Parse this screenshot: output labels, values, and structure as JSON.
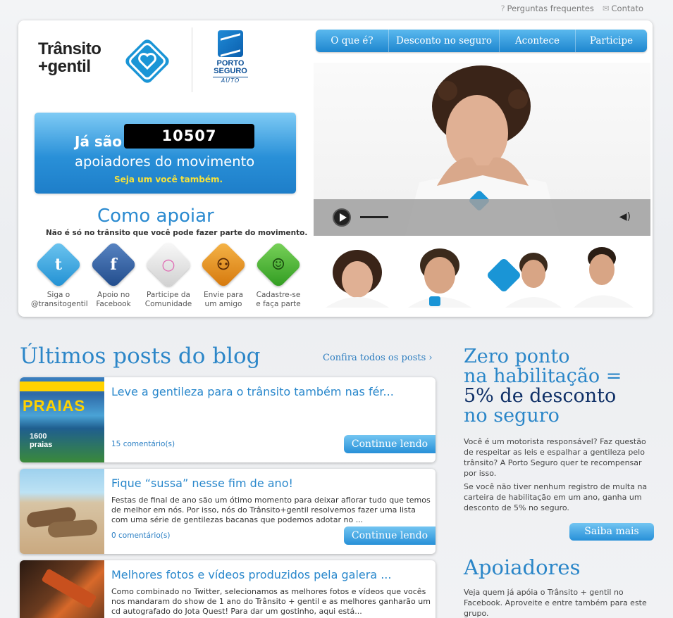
{
  "utility": {
    "faq": "Perguntas frequentes",
    "contact": "Contato"
  },
  "logo": {
    "line1": "Trânsito",
    "line2": "+gentil",
    "partner1": "PORTO",
    "partner2": "SEGURO",
    "partner3": "AUTO"
  },
  "nav": [
    "O que é?",
    "Desconto no seguro",
    "Acontece",
    "Participe"
  ],
  "counter": {
    "prefix": "Já são",
    "number": "10507",
    "text": "apoiadores do movimento",
    "sub": "Seja um você também."
  },
  "como": {
    "title": "Como apoiar",
    "sub": "Não é só no trânsito que você pode fazer parte do movimento."
  },
  "support_icons": [
    {
      "icon": "twitter-icon",
      "color": "#2ea1dc",
      "glyph": "t",
      "l1": "Siga o",
      "l2": "@transitogentil"
    },
    {
      "icon": "facebook-icon",
      "color": "#2c5c9c",
      "glyph": "f",
      "l1": "Apoio no",
      "l2": "Facebook"
    },
    {
      "icon": "community-icon",
      "color": "#d8d8d8",
      "glyph": "○",
      "l1": "Participe da",
      "l2": "Comunidade"
    },
    {
      "icon": "friends-icon",
      "color": "#e08a14",
      "glyph": "⚇",
      "l1": "Envie para",
      "l2": "um amigo"
    },
    {
      "icon": "signup-icon",
      "color": "#3dae2b",
      "glyph": "☺",
      "l1": "Cadastre-se",
      "l2": "e faça parte"
    }
  ],
  "blog": {
    "title": "Últimos posts do blog",
    "all_link": "Confira todos os posts ›",
    "posts": [
      {
        "title": "Leve a gentileza para o trânsito também nas fér...",
        "excerpt": "",
        "comments": "15 comentário(s)",
        "button": "Continue lendo"
      },
      {
        "title": "Fique “sussa” nesse fim de ano!",
        "excerpt": "Festas de final de ano são um ótimo momento para deixar aflorar tudo que temos de melhor em nós. Por isso, nós do Trânsito+gentil resolvemos fazer uma lista com uma série de gentilezas bacanas que podemos adotar no ...",
        "comments": "0 comentário(s)",
        "button": "Continue lendo"
      },
      {
        "title": "Melhores fotos e vídeos produzidos pela galera ...",
        "excerpt": "Como combinado no Twitter, selecionamos as melhores fotos e vídeos que vocês nos mandaram do show de 1 ano do Trânsito + gentil e as melhores ganharão um cd autografado do Jota Quest! Para dar um gostinho, aqui está...",
        "comments": "",
        "button": ""
      }
    ]
  },
  "sidebar": {
    "h1": "Zero ponto",
    "h2": "na habilitação =",
    "h3": "5% de desconto",
    "h4": "no seguro",
    "p1": "Você é um motorista responsável? Faz questão de respeitar as leis e espalhar a gentileza pelo trânsito? A Porto Seguro quer te recompensar por isso.",
    "p2": "Se você não tiver nenhum registro de multa na carteira de habilitação em um ano, ganha um desconto de 5% no seguro.",
    "button": "Saiba mais",
    "apoiadores": "Apoiadores",
    "p3": "Veja quem já apóia o Trânsito + gentil no Facebook. Aproveite e entre também para este grupo."
  },
  "colors": {
    "accent": "#2a86c8",
    "dark": "#0e2f66",
    "highlight": "#f6e23a"
  }
}
